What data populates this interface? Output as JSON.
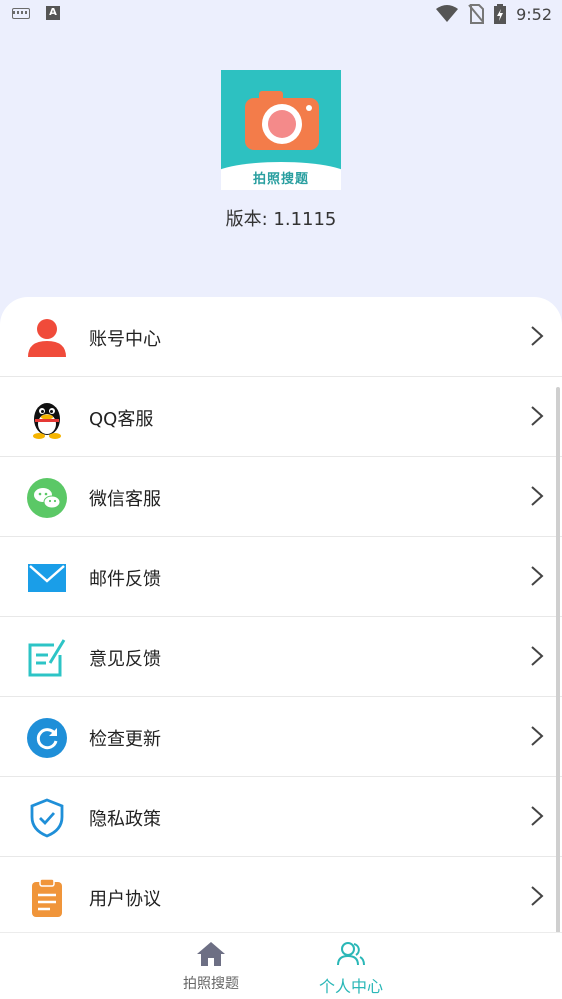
{
  "status_bar": {
    "time": "9:52",
    "left_icons": [
      "keyboard-icon",
      "a-icon"
    ],
    "a_icon_letter": "A",
    "right_icons": [
      "wifi-icon",
      "no-sim-icon",
      "battery-charging-icon"
    ]
  },
  "app": {
    "logo_text": "拍照搜题",
    "version_label": "版本: 1.1115"
  },
  "menu": {
    "items": [
      {
        "label": "账号中心",
        "icon": "user-icon",
        "color": "#f04b3a"
      },
      {
        "label": "QQ客服",
        "icon": "qq-penguin-icon",
        "color": "#111111"
      },
      {
        "label": "微信客服",
        "icon": "wechat-icon",
        "color": "#5bc866"
      },
      {
        "label": "邮件反馈",
        "icon": "mail-icon",
        "color": "#1a9ee8"
      },
      {
        "label": "意见反馈",
        "icon": "edit-note-icon",
        "color": "#2dc4c6"
      },
      {
        "label": "检查更新",
        "icon": "refresh-icon",
        "color": "#1f8fd8"
      },
      {
        "label": "隐私政策",
        "icon": "shield-check-icon",
        "color": "#1f8fd8"
      },
      {
        "label": "用户协议",
        "icon": "clipboard-icon",
        "color": "#f0953a"
      }
    ]
  },
  "bottom_nav": {
    "tabs": [
      {
        "label": "拍照搜题",
        "icon": "home-icon",
        "active": false
      },
      {
        "label": "个人中心",
        "icon": "users-icon",
        "active": true
      }
    ],
    "active_color": "#2ab7b7",
    "inactive_color": "#666666"
  }
}
